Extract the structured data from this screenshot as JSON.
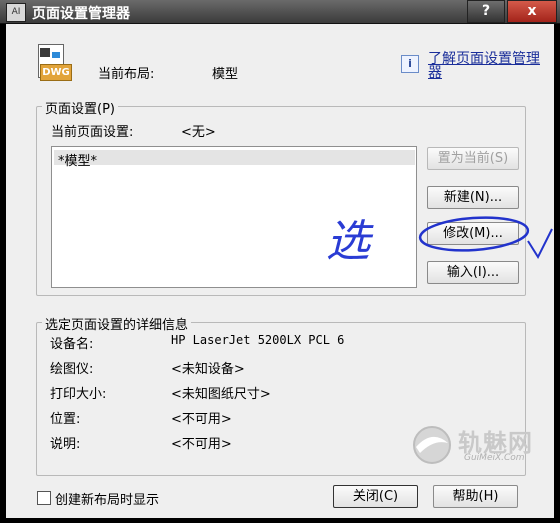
{
  "window": {
    "title": "页面设置管理器",
    "help_glyph": "?",
    "close_glyph": "x",
    "icon_label": "AI"
  },
  "current_layout": {
    "icon_text": "DWG",
    "label": "当前布局:",
    "value": "模型"
  },
  "help_link": {
    "icon": "i",
    "text": "了解页面设置管理器"
  },
  "page_setup": {
    "group_label": "页面设置(P)",
    "current_label": "当前页面设置:",
    "current_value": "<无>",
    "list_items": [
      "*模型*"
    ],
    "buttons": {
      "set_current": "置为当前(S)",
      "new": "新建(N)...",
      "modify": "修改(M)...",
      "import": "输入(I)..."
    }
  },
  "annotations": {
    "handwritten": "选"
  },
  "details": {
    "group_label": "选定页面设置的详细信息",
    "rows": [
      {
        "label": "设备名:",
        "value": "HP LaserJet 5200LX PCL 6"
      },
      {
        "label": "绘图仪:",
        "value": "<未知设备>"
      },
      {
        "label": "打印大小:",
        "value": "<未知图纸尺寸>"
      },
      {
        "label": "位置:",
        "value": "<不可用>"
      },
      {
        "label": "说明:",
        "value": "<不可用>"
      }
    ]
  },
  "footer": {
    "checkbox_label": "创建新布局时显示",
    "checkbox_checked": false,
    "close_button": "关闭(C)",
    "help_button": "帮助(H)"
  },
  "watermark": {
    "text": "轨魅网",
    "subtext": "GuiMeiX.Com"
  }
}
